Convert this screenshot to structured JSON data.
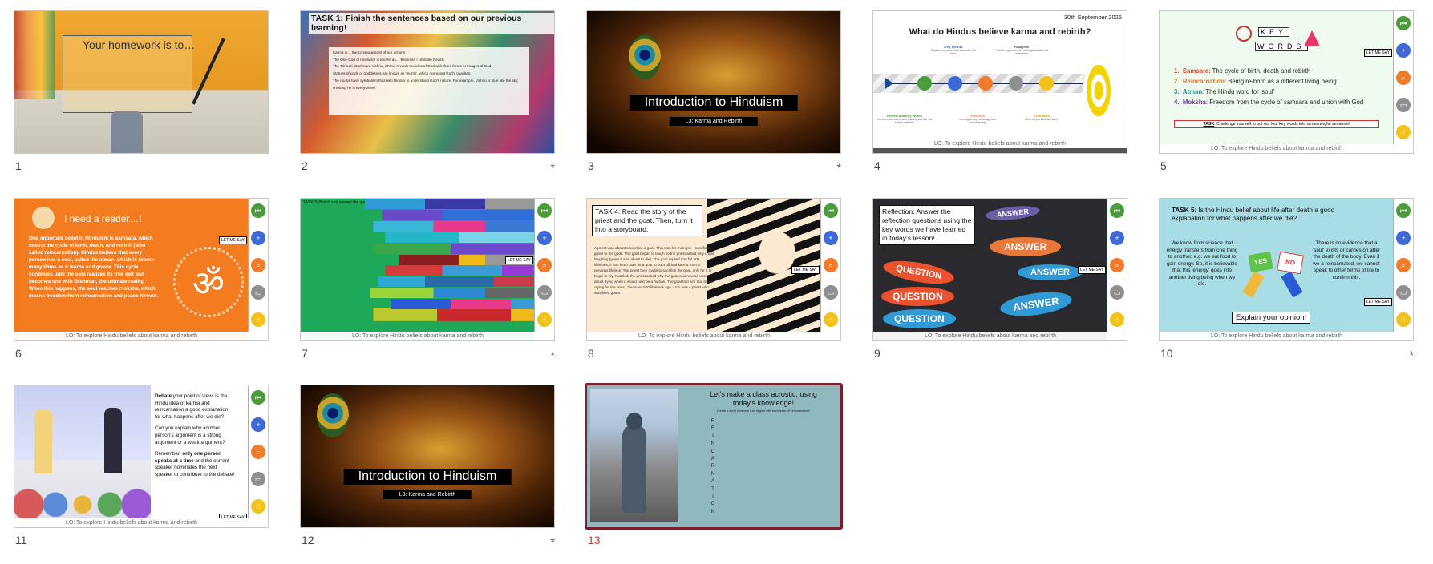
{
  "slides": [
    {
      "number": "1",
      "starred": false,
      "text": {
        "homework": "Your homework is to…"
      }
    },
    {
      "number": "2",
      "starred": true,
      "text": {
        "task": "TASK 1: Finish the sentences based on our previous learning!",
        "line1": "Karma is… the consequences of our actions",
        "line2": "The One God of Hinduism is known as… Brahman / Ultimate Reality",
        "line3": "The Trimurti (Brahman, Vishnu, Shiva) reveals the idea of God with three forms or images of God.",
        "line4": "Statues of gods or goddesses are known as 'murtis', which represent God's qualities.",
        "line5": "The murtis have symbolism that help Hindus to understand God's nature. For example, Vishnu is blue like the sky, showing he is everywhere."
      }
    },
    {
      "number": "3",
      "starred": true,
      "text": {
        "title": "Introduction to Hinduism",
        "subtitle": "L3: Karma and Rebirth"
      }
    },
    {
      "number": "4",
      "starred": false,
      "text": {
        "date": "30th September 2025",
        "title": "What do Hindus believe karma and rebirth?",
        "key_words": "Key Words",
        "key_words_desc": "Explain key words and introduce the topic",
        "analysis": "Analysis",
        "analysis_desc": "Provide arguments for and against different viewpoints",
        "review": "Review and Key Words",
        "review_desc": "Remind ourselves of prior learning and link it to today's objective",
        "evidence": "Evidence",
        "evidence_desc": "Investigate key knowledge and understanding",
        "evaluation": "Evaluation",
        "evaluation_desc": "What do you think and why?",
        "lo": "LO: To explore Hindu beliefs about karma and rebirth"
      }
    },
    {
      "number": "5",
      "starred": false,
      "text": {
        "kw1": "KEY",
        "kw2": "WORDS",
        "items": [
          {
            "n": "1.",
            "term": "Samsara",
            "def": ": The cycle of birth, death and rebirth",
            "color": "#e0452b"
          },
          {
            "n": "2.",
            "term": "Reincarnation",
            "def": ": Being re-born as a different living being",
            "color": "#e0702b"
          },
          {
            "n": "3.",
            "term": "Atman",
            "def": ": The Hindu word for 'soul'",
            "color": "#2a8a8a"
          },
          {
            "n": "4.",
            "term": "Moksha",
            "def": ": Freedom from the cycle of samsara and union with God",
            "color": "#6a3a9a"
          }
        ],
        "task_label": "TASK",
        "task_text": ": Challenge yourself to put our four key words into a meaningful sentence!",
        "lo": "LO: To explore Hindu beliefs about karma and rebirth"
      }
    },
    {
      "number": "6",
      "starred": false,
      "text": {
        "heading": "I need a reader…!",
        "body": "One important belief in Hinduism is samsara, which means the cycle of birth, death, and rebirth (also called reincarnation). Hindus believe that every person has a soul, called the atman, which is reborn many times as it learns and grows. This cycle continues until the soul realizes its true self and becomes one with Brahman, the ultimate reality. When this happens, the soul reaches moksha, which means freedom from reincarnation and peace forever.",
        "om": "ॐ",
        "lo": "LO: To explore Hindu beliefs about karma and rebirth"
      }
    },
    {
      "number": "7",
      "starred": true,
      "text": {
        "task": "TASK 3: Watch and answer the questions!",
        "lo": "LO: To explore Hindu beliefs about karma and rebirth"
      }
    },
    {
      "number": "8",
      "starred": false,
      "text": {
        "task": "TASK 4: Read the story of the priest and the goat. Then, turn it into a storyboard.",
        "story": "A priest was about to sacrifice a goat. This was his main job—sacrificing goats to the gods. The goat began to laugh so the priest asked why it was laughing (given it was about to die). The goat replied that for 500 lifetimes, it can been born as a goat to burn off bad karma from a previous lifetime. The priest then made to sacrifice the goat, only for it to begin to cry. Puzzled, the priest asked why the goat was now so upset about dying when it would next be a human. The goat told him that it was crying for the priest, 'because 500 lifetimes ago, I too was a priest who sacrificed goats.'",
        "lo": "LO: To explore Hindu beliefs about karma and rebirth"
      }
    },
    {
      "number": "9",
      "starred": false,
      "text": {
        "reflection": "Reflection: Answer the reflection questions using the key words we have learned in today's lesson!",
        "bubbles": [
          "ANSWER",
          "ANSWER",
          "QUESTION",
          "ANSWER",
          "QUESTION",
          "ANSWER",
          "QUESTION"
        ],
        "lo": "LO: To explore Hindu beliefs about karma and rebirth"
      }
    },
    {
      "number": "10",
      "starred": true,
      "text": {
        "task_label": "TASK 5:",
        "task": " Is the Hindu belief about life after death a good explanation for what happens after we die?",
        "left": "We know from science that energy transfers from one thing to another, e.g. we eat food to gain energy. So, it is believable that this 'energy' goes into another living being when we die.",
        "right": "There is no evidence that a 'soul' exists or carries on after the death of the body. Even if we a reincarnated, we cannot speak to other forms of life to confirm this.",
        "yes": "YES",
        "no": "NO",
        "opinion": "Explain your opinion!",
        "lo": "LO: To explore Hindu beliefs about karma and rebirth"
      }
    },
    {
      "number": "11",
      "starred": false,
      "text": {
        "p1_bold": "Debate",
        "p1": " your point of view: is the Hindu idea of karma and reincarnation a good explanation for what happens after we die?",
        "p2": "Can you explain why another person's argument is a strong argument or a weak argument?",
        "p3_a": "Remember, ",
        "p3_bold": "only one person speaks at a time",
        "p3_b": " and the current speaker nominates the next speaker to contribute to the debate!",
        "lo": "LO: To explore Hindu beliefs about karma and rebirth"
      }
    },
    {
      "number": "12",
      "starred": true,
      "text": {
        "title": "Introduction to Hinduism",
        "subtitle": "L3: Karma and Rebirth"
      }
    },
    {
      "number": "13",
      "starred": false,
      "selected": true,
      "text": {
        "title": "Let's make a class acrostic, using today's knowledge!",
        "instruction": "Create a short sentence that begins with each letter of 'reincarnation'!",
        "letters": [
          "R",
          "E",
          "I",
          "N",
          "C",
          "A",
          "R",
          "N",
          "A",
          "T",
          "I",
          "O",
          "N"
        ]
      }
    }
  ],
  "sidebar_tag": "LET ME SAY",
  "star_glyph": "*"
}
